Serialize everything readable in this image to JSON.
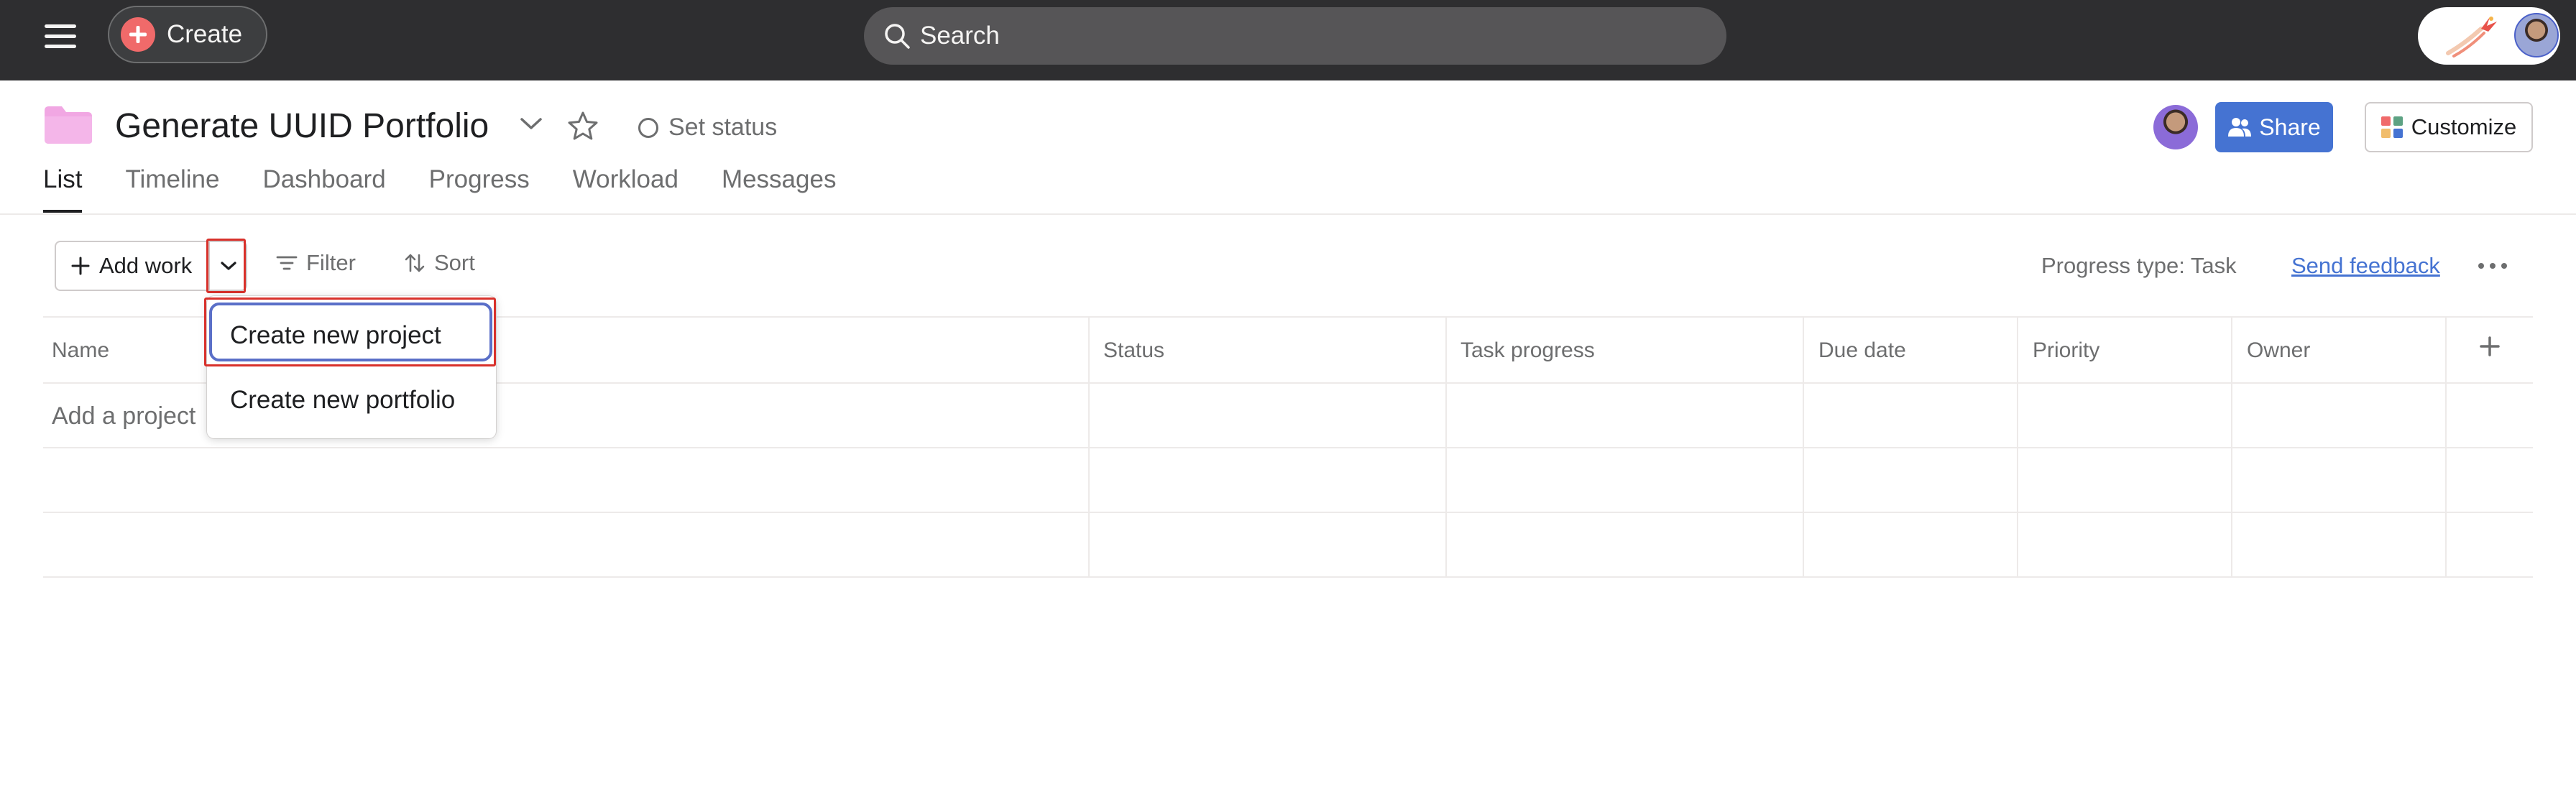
{
  "topbar": {
    "create_label": "Create",
    "search_placeholder": "Search"
  },
  "header": {
    "title": "Generate UUID Portfolio",
    "set_status": "Set status",
    "share_label": "Share",
    "customize_label": "Customize"
  },
  "tabs": [
    {
      "label": "List",
      "active": true
    },
    {
      "label": "Timeline"
    },
    {
      "label": "Dashboard"
    },
    {
      "label": "Progress"
    },
    {
      "label": "Workload"
    },
    {
      "label": "Messages"
    }
  ],
  "toolbar": {
    "add_work": "Add work",
    "filter": "Filter",
    "sort": "Sort",
    "progress_type": "Progress type: Task",
    "send_feedback": "Send feedback"
  },
  "table": {
    "columns": [
      "Name",
      "Status",
      "Task progress",
      "Due date",
      "Priority",
      "Owner"
    ],
    "add_row_placeholder": "Add a project"
  },
  "dropdown": {
    "items": [
      "Create new project",
      "Create new portfolio"
    ]
  },
  "colors": {
    "topbar_bg": "#2e2e30",
    "accent_blue": "#4573d2",
    "create_red": "#f06a6a",
    "folder_pink": "#f1a7e3",
    "highlight_red": "#d8312b"
  }
}
